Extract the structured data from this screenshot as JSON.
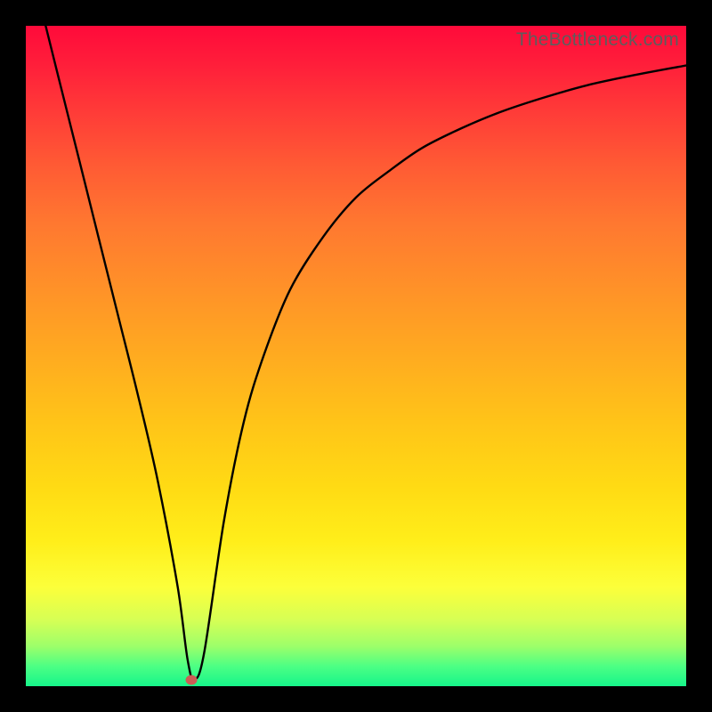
{
  "watermark": "TheBottleneck.com",
  "chart_data": {
    "type": "line",
    "title": "",
    "xlabel": "",
    "ylabel": "",
    "xlim": [
      0,
      100
    ],
    "ylim": [
      0,
      100
    ],
    "grid": false,
    "legend": false,
    "series": [
      {
        "name": "curve",
        "x": [
          3,
          5,
          8,
          11,
          14,
          17,
          20,
          23,
          24.5,
          25.5,
          27,
          30,
          33,
          36,
          40,
          45,
          50,
          55,
          60,
          66,
          72,
          78,
          85,
          92,
          100
        ],
        "y": [
          100,
          92,
          80,
          68,
          56,
          44,
          31,
          15,
          4,
          1,
          5,
          25,
          40,
          50,
          60,
          68,
          74,
          78,
          81.5,
          84.5,
          87,
          89,
          91,
          92.5,
          94
        ]
      }
    ],
    "marker": {
      "x": 25,
      "y": 1
    },
    "gradient_stops": [
      {
        "pos": 0,
        "color": "#ff0a3a"
      },
      {
        "pos": 50,
        "color": "#ffab20"
      },
      {
        "pos": 85,
        "color": "#fcff3a"
      },
      {
        "pos": 100,
        "color": "#16f58a"
      }
    ]
  }
}
